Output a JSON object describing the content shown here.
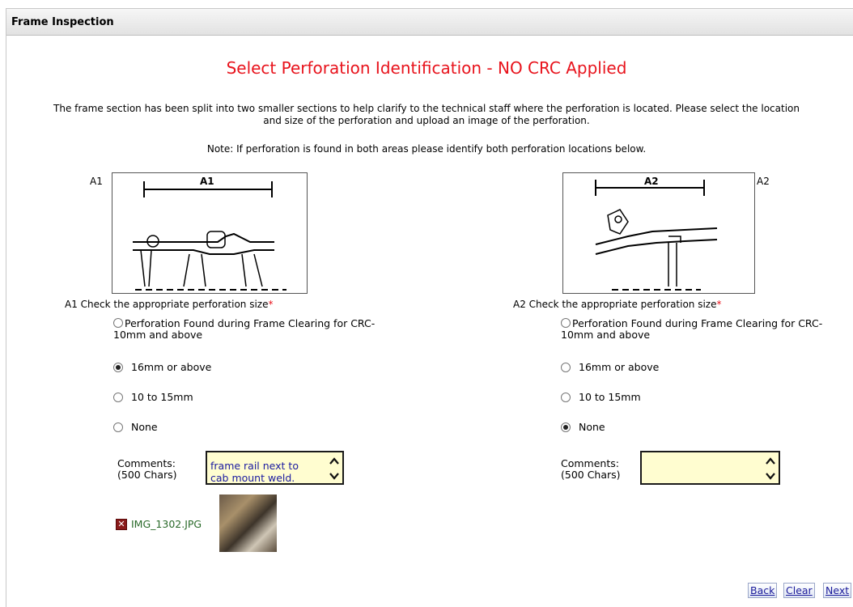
{
  "header": {
    "title": "Frame Inspection"
  },
  "page": {
    "title": "Select Perforation Identification - NO CRC Applied",
    "intro_line1": "The frame section has been split into two smaller sections to help clarify to the technical staff where the perforation is located. Please select the location",
    "intro_line2": "and size of the perforation and upload an image of the perforation.",
    "note": "Note: If perforation is found in both areas please identify both perforation locations below."
  },
  "sections": [
    {
      "id": "A1",
      "diagram_label": "A1",
      "diagram_caption": "A1",
      "question": "A1  Check the appropriate perforation size",
      "required_mark": "*",
      "options": [
        {
          "line1": "Perforation Found during Frame Clearing for CRC-",
          "line2": "10mm and above",
          "selected": false
        },
        {
          "label": "16mm or above",
          "selected": true
        },
        {
          "label": "10 to 15mm",
          "selected": false
        },
        {
          "label": "None",
          "selected": false
        }
      ],
      "comments_label_1": "Comments:",
      "comments_label_2": "(500 Chars)",
      "comments_visible_lines": [
        "frame rail next to",
        "cab mount weld."
      ],
      "attachment": {
        "filename": "IMG_1302.JPG",
        "delete_icon": "x-icon"
      }
    },
    {
      "id": "A2",
      "diagram_label": "A2",
      "diagram_caption": "A2",
      "question": "A2  Check the appropriate perforation size",
      "required_mark": "*",
      "options": [
        {
          "line1": "Perforation Found during Frame Clearing for CRC-",
          "line2": "10mm and above",
          "selected": false
        },
        {
          "label": "16mm or above",
          "selected": false
        },
        {
          "label": "10 to 15mm",
          "selected": false
        },
        {
          "label": "None",
          "selected": true
        }
      ],
      "comments_label_1": "Comments:",
      "comments_label_2": "(500 Chars)",
      "comments_value": ""
    }
  ],
  "buttons": {
    "back": "Back",
    "clear": "Clear",
    "next": "Next"
  },
  "colors": {
    "title_red": "#e8131c",
    "comment_bg": "#fffdd0",
    "link_blue": "#1a1a9a"
  }
}
